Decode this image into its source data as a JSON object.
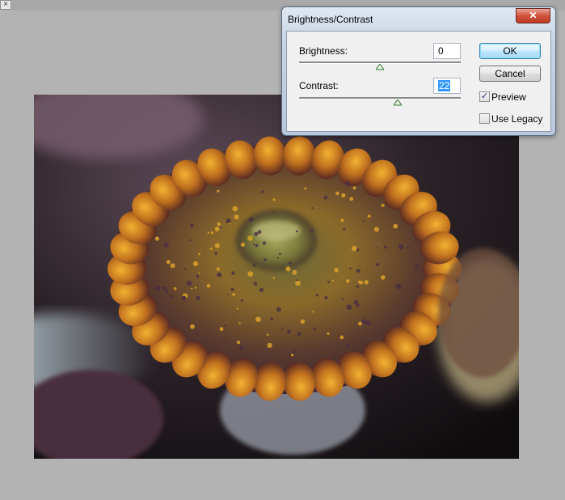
{
  "document": {
    "close_glyph": "×"
  },
  "dialog": {
    "title": "Brightness/Contrast",
    "close_glyph": "✕",
    "brightness": {
      "label": "Brightness:",
      "value": "0",
      "slider_fraction": 0.5
    },
    "contrast": {
      "label": "Contrast:",
      "value": "22",
      "slider_fraction": 0.61
    },
    "ok_label": "OK",
    "cancel_label": "Cancel",
    "preview": {
      "label": "Preview",
      "checked": true,
      "mark": "✓"
    },
    "use_legacy": {
      "label": "Use Legacy",
      "checked": false
    }
  },
  "colors": {
    "title_bar": "#c6d3e4",
    "close_button": "#d0533d",
    "selection": "#3399ff",
    "slider_thumb": "#3a7a3a"
  },
  "icons": [
    "close-icon",
    "slider-thumb-icon",
    "checkmark-icon"
  ]
}
